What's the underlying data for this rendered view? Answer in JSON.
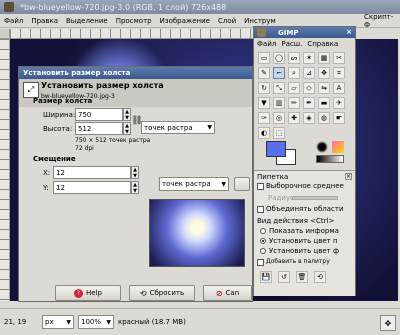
{
  "image_window": {
    "title": "*bw-blueyellow-720.jpg-3.0 (RGB, 1 слой) 726x488",
    "menu": [
      "Файл",
      "Правка",
      "Выделение",
      "Просмотр",
      "Изображение",
      "Слой",
      "Инструм"
    ],
    "menu_right": "Скрипт-Ф",
    "status": {
      "coords": "21, 19",
      "unit": "px",
      "zoom": "100%",
      "info": "красный (18.7 MB)"
    }
  },
  "gimp_toolbox": {
    "title": "GIMP",
    "menu": [
      "Файл",
      "Расш.",
      "Справка"
    ],
    "tools": [
      "rect-select",
      "ellipse-select",
      "free-select",
      "fuzzy-select",
      "by-color-select",
      "scissors",
      "paths",
      "color-picker",
      "zoom",
      "measure",
      "move",
      "crop",
      "rotate",
      "scale",
      "shear",
      "perspective",
      "flip",
      "text",
      "bucket-fill",
      "blend",
      "pencil",
      "paintbrush",
      "eraser",
      "airbrush",
      "ink",
      "clone",
      "heal",
      "perspective-clone",
      "convolve",
      "smudge",
      "dodge-burn",
      "foreground-select"
    ]
  },
  "tool_options": {
    "title": "Пипетка",
    "sample_average": "Выборочное среднее",
    "radius_label": "Радиус:",
    "sample_merged": "Объединять области",
    "action_label": "Вид действия  <Ctrl>",
    "options": [
      "Показать информа",
      "Установить цвет п",
      "Установить цвет ф"
    ],
    "add_palette": "Добавить в палитру"
  },
  "dialog": {
    "title": "Установить размер холста",
    "subtitle": "bw-blueyellow-720.jpg-3",
    "canvas_size_label": "Размер холста",
    "width_label": "Ширина:",
    "width_value": "750",
    "height_label": "Высота:",
    "height_value": "512",
    "size_info": "750 × 512 точек растра",
    "dpi_info": "72 dpi",
    "unit": "точек растра",
    "offset_label": "Смещение",
    "x_label": "X:",
    "x_value": "12",
    "y_label": "Y:",
    "y_value": "12",
    "offset_unit": "точек растра",
    "buttons": {
      "help": "Help",
      "reset": "Сбросить",
      "cancel": "Can"
    }
  },
  "colors": {
    "titlebar": "#4a6a9e",
    "foreground": "#5a6ff0",
    "background": "#ffffff",
    "dialog_bg": "#dcdad5"
  }
}
